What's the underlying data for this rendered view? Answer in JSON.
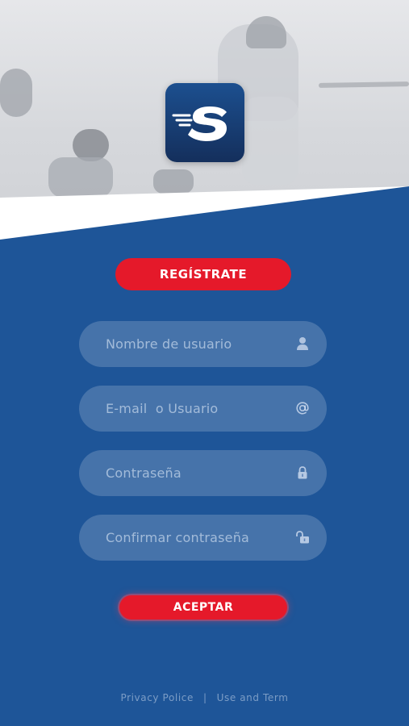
{
  "app": {
    "logo_letter": "S"
  },
  "register": {
    "label": "REGÍSTRATE"
  },
  "form": {
    "fields": [
      {
        "placeholder": "Nombre de usuario",
        "icon": "user-icon"
      },
      {
        "placeholder": "E-mail  o Usuario",
        "icon": "at-icon"
      },
      {
        "placeholder": "Contraseña",
        "icon": "lock-icon"
      },
      {
        "placeholder": "Confirmar contraseña",
        "icon": "unlock-icon"
      }
    ],
    "submit_label": "ACEPTAR"
  },
  "footer": {
    "privacy_label": "Privacy Police",
    "separator": "|",
    "terms_label": "Use and Term"
  },
  "colors": {
    "background_blue": "#1e5598",
    "accent_red": "#e5192a",
    "logo_blue": "#142f5c"
  }
}
